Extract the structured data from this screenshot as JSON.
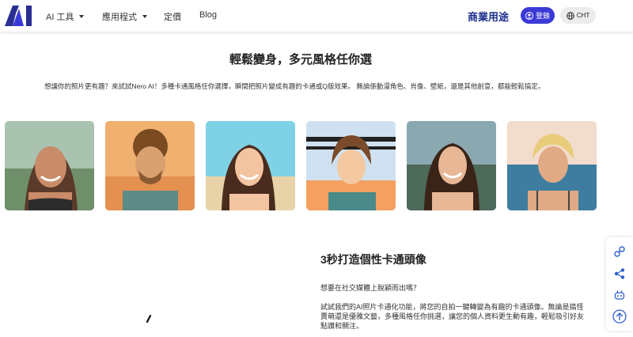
{
  "nav": {
    "logo_text": "AI",
    "items": [
      {
        "label": "AI 工具",
        "has_dropdown": true
      },
      {
        "label": "應用程式",
        "has_dropdown": true
      },
      {
        "label": "定價",
        "has_dropdown": false
      },
      {
        "label": "Blog",
        "has_dropdown": false
      }
    ],
    "business_label": "商業用途",
    "login_label": "登錄",
    "language_label": "CHT",
    "accent_color": "#3b39d6"
  },
  "hero": {
    "title": "輕鬆變身，多元風格任你選",
    "description": "想讓你的照片更有趣？來試試Nero AI！多種卡通風格任你選擇，瞬間把照片變成有趣的卡通或Q版效果。 無論係動漫角色、肖像、壁紙，還是其他創意，都能輕鬆搞定。"
  },
  "gallery": {
    "images": [
      {
        "icon": "cartoon-portrait-woman-mountains"
      },
      {
        "icon": "cartoon-portrait-man-curly-sunset"
      },
      {
        "icon": "cartoon-portrait-woman-beach-smile"
      },
      {
        "icon": "anime-portrait-man-bridge"
      },
      {
        "icon": "cartoon-portrait-woman-coast"
      },
      {
        "icon": "cartoon-portrait-man-blonde-sea"
      }
    ]
  },
  "feature": {
    "title": "3秒打造個性卡通頭像",
    "question": "想要在社交媒體上脫穎而出嗎？",
    "body": "試試我們的AI照片卡通化功能，將您的自拍一鍵轉變為有趣的卡通頭像。無論是搞怪賣萌還是優雅文藝，多種風格任你挑選，讓您的個人資料更生動有趣，輕鬆吸引好友點讚和關注。"
  },
  "sidebar": {
    "buttons": [
      "link-icon",
      "share-icon",
      "bot-icon",
      "arrow-up-icon"
    ]
  }
}
